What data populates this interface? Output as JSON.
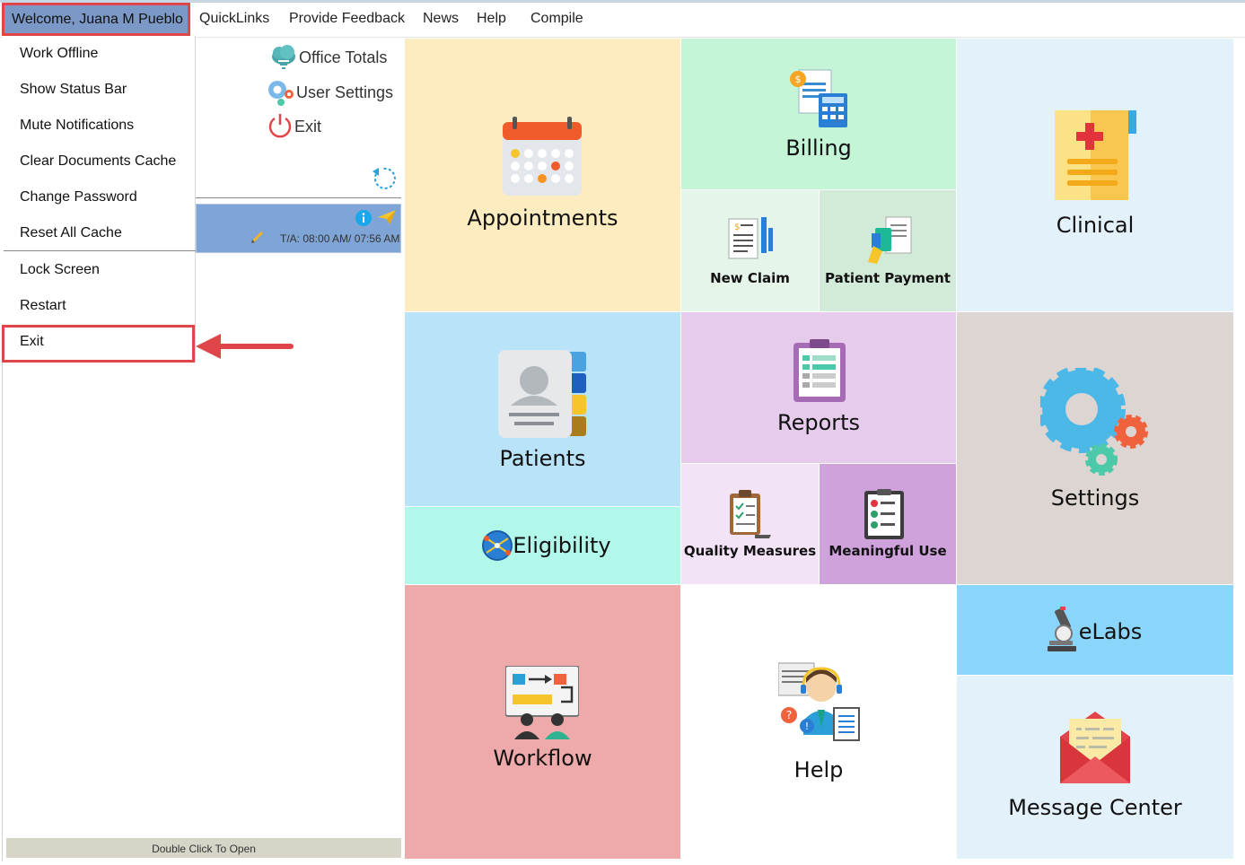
{
  "menubar": {
    "welcome": "Welcome, Juana M Pueblo",
    "items": [
      "QuickLinks",
      "Provide Feedback",
      "News",
      "Help",
      "Compile"
    ]
  },
  "user_menu": {
    "items": [
      "Work Offline",
      "Show Status Bar",
      "Mute Notifications",
      "Clear Documents Cache",
      "Change Password",
      "Reset All Cache",
      "Lock Screen",
      "Restart",
      "Exit"
    ]
  },
  "quick_actions": {
    "office_totals": "Office Totals",
    "user_settings": "User Settings",
    "exit": "Exit"
  },
  "appointment_card": {
    "time": "T/A: 08:00 AM/ 07:56 AM"
  },
  "footer": {
    "text": "Double Click To Open"
  },
  "tiles": {
    "appointments": "Appointments",
    "billing": "Billing",
    "new_claim": "New Claim",
    "patient_payment": "Patient Payment",
    "clinical": "Clinical",
    "patients": "Patients",
    "eligibility": "Eligibility",
    "reports": "Reports",
    "quality_measures": "Quality Measures",
    "meaningful_use": "Meaningful Use",
    "settings": "Settings",
    "workflow": "Workflow",
    "help": "Help",
    "elabs": "eLabs",
    "message_center": "Message Center"
  },
  "colors": {
    "highlight_red": "#e0454a",
    "welcome_bg": "#7b98c6",
    "appointments": "#fdecc0",
    "billing": "#c3f5d6",
    "new_claim": "#e6f5ea",
    "patient_payment": "#d2ebd8",
    "clinical": "#e3f1fb",
    "patients": "#b8e3f8",
    "eligibility": "#b2f8ea",
    "reports": "#e6cbec",
    "quality_measures": "#f3e3f6",
    "meaningful_use": "#cfa2dc",
    "settings": "#ddd5d2",
    "workflow": "#eeaaaa",
    "help": "#ffffff",
    "elabs": "#8ad5fa",
    "message_center": "#e3f1fb"
  }
}
